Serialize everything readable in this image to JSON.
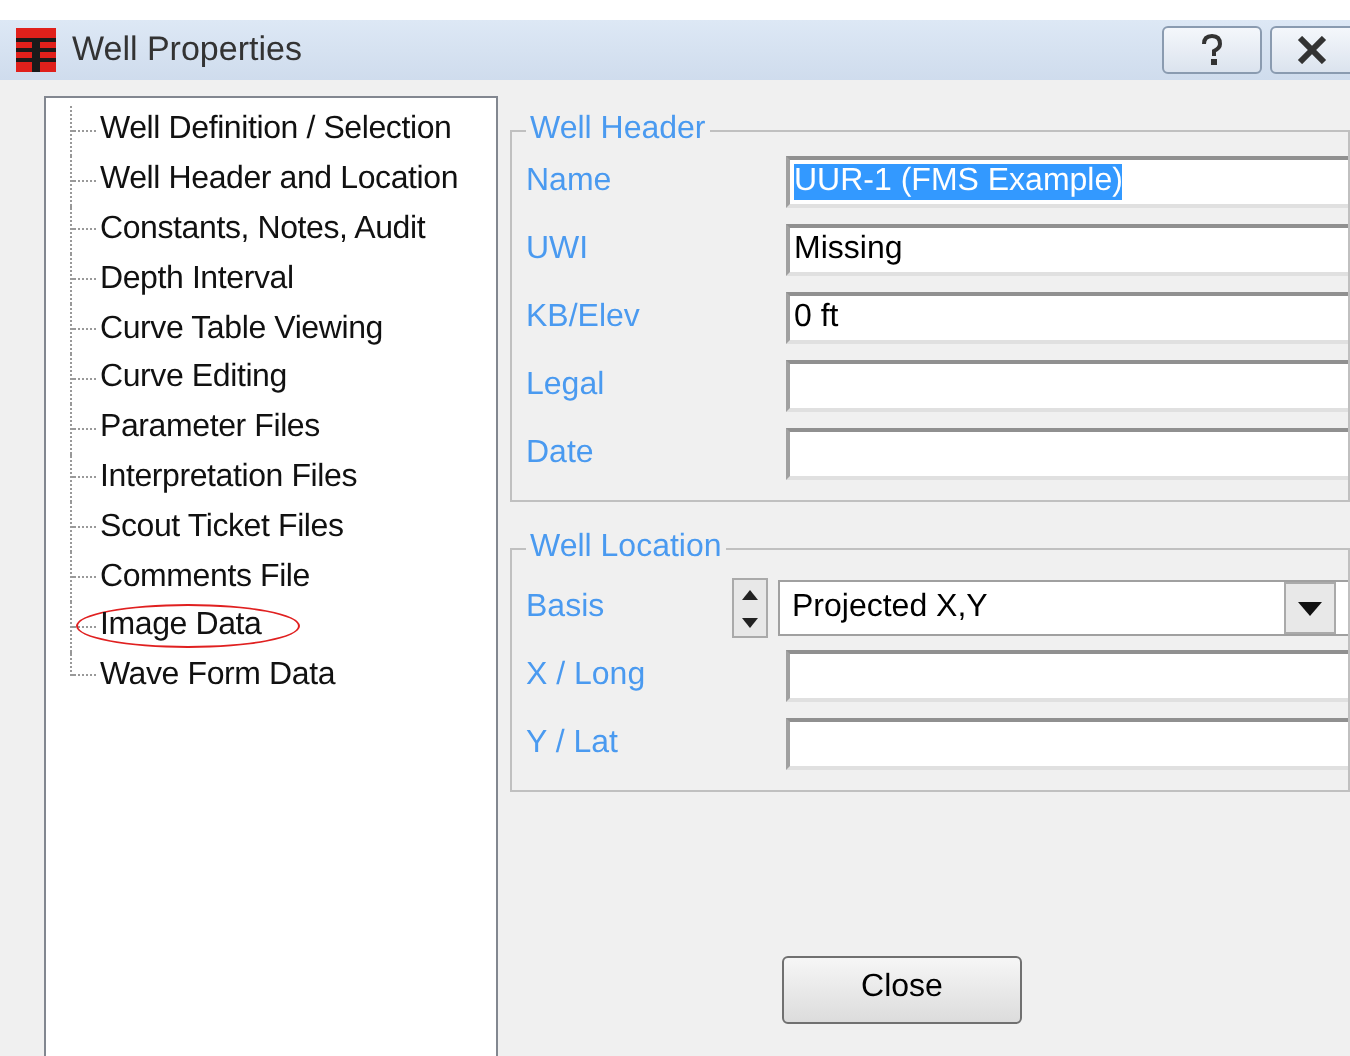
{
  "window": {
    "title": "Well Properties"
  },
  "tree": {
    "items": [
      {
        "label": "Well Definition / Selection",
        "circled": false
      },
      {
        "label": "Well Header and Location",
        "circled": false
      },
      {
        "label": "Constants, Notes, Audit",
        "circled": false
      },
      {
        "label": "Depth Interval",
        "circled": false
      },
      {
        "label": "Curve Table Viewing",
        "circled": false
      },
      {
        "label": "Curve Editing",
        "circled": false
      },
      {
        "label": "Parameter Files",
        "circled": false
      },
      {
        "label": "Interpretation Files",
        "circled": false
      },
      {
        "label": "Scout Ticket Files",
        "circled": false
      },
      {
        "label": "Comments File",
        "circled": false
      },
      {
        "label": "Image Data",
        "circled": true
      },
      {
        "label": "Wave Form Data",
        "circled": false
      }
    ]
  },
  "well_header": {
    "title": "Well Header",
    "fields": [
      {
        "label": "Name",
        "value": "UUR-1 (FMS Example)",
        "text_selected": true
      },
      {
        "label": "UWI",
        "value": "Missing",
        "text_selected": false
      },
      {
        "label": "KB/Elev",
        "value": "0 ft",
        "text_selected": false
      },
      {
        "label": "Legal"
      },
      {
        "label": "Date"
      }
    ]
  },
  "well_location": {
    "title": "Well Location",
    "basis": {
      "label": "Basis",
      "value": "Projected X,Y"
    },
    "fields": [
      {
        "label": "X / Long"
      },
      {
        "label": "Y / Lat"
      }
    ]
  },
  "close_button": "Close"
}
